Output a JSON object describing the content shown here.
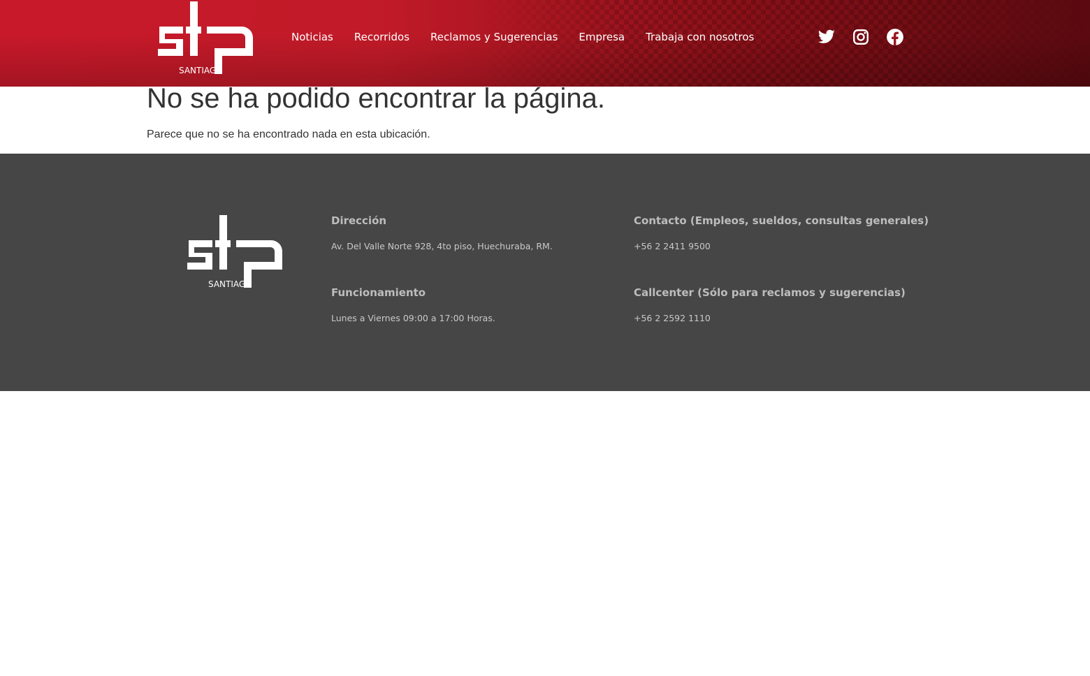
{
  "header": {
    "logo": {
      "text": "stp",
      "subtitle": "SANTIAGO"
    },
    "nav": [
      {
        "label": "Noticias"
      },
      {
        "label": "Recorridos"
      },
      {
        "label": "Reclamos y Sugerencias"
      },
      {
        "label": "Empresa"
      },
      {
        "label": "Trabaja con nosotros"
      }
    ],
    "social": [
      {
        "icon": "twitter-icon"
      },
      {
        "icon": "instagram-icon"
      },
      {
        "icon": "facebook-icon"
      }
    ],
    "colors": {
      "brand_red": "#c8192a",
      "dark_red": "#5a0a10"
    }
  },
  "main": {
    "title": "No se ha podido encontrar la página.",
    "message": "Parece que no se ha encontrado nada en esta ubicación."
  },
  "footer": {
    "background": "#464646",
    "logo": {
      "text": "stp",
      "subtitle": "SANTIAGO"
    },
    "direccion": {
      "heading": "Dirección",
      "text": "Av. Del Valle Norte 928, 4to piso, Huechuraba, RM."
    },
    "funcionamiento": {
      "heading": "Funcionamiento",
      "text": "Lunes a Viernes 09:00 a 17:00 Horas."
    },
    "contacto": {
      "heading": "Contacto (Empleos, sueldos, consultas generales)",
      "text": "+56 2 2411 9500"
    },
    "callcenter": {
      "heading": "Callcenter (Sólo para reclamos y sugerencias)",
      "text": "+56 2 2592 1110"
    }
  }
}
